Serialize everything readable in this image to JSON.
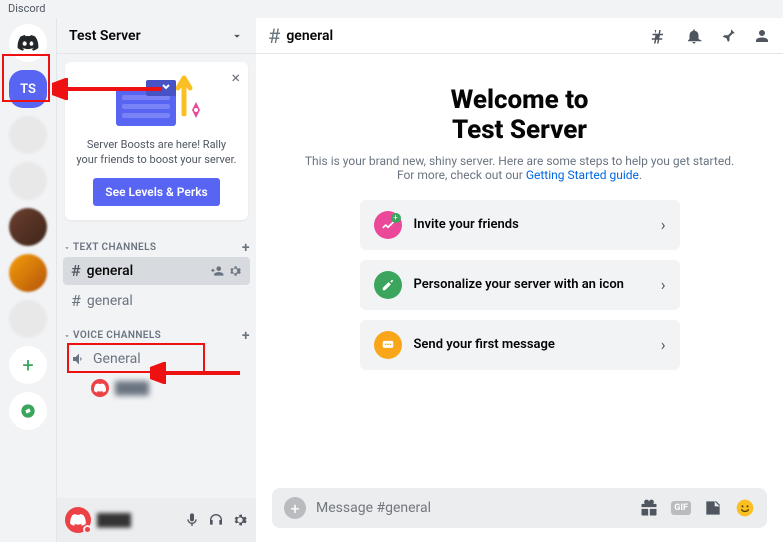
{
  "app": {
    "title": "Discord"
  },
  "server_rail": {
    "selected_label": "TS"
  },
  "sidebar": {
    "server_name": "Test Server",
    "boost": {
      "text": "Server Boosts are here! Rally your friends to boost your server.",
      "button": "See Levels & Perks"
    },
    "sections": {
      "text_channels": {
        "label": "TEXT CHANNELS",
        "items": [
          {
            "name": "general",
            "active": true
          },
          {
            "name": "general",
            "active": false
          }
        ]
      },
      "voice_channels": {
        "label": "VOICE CHANNELS",
        "items": [
          {
            "name": "General"
          }
        ]
      }
    }
  },
  "main": {
    "channel_name": "general",
    "welcome": {
      "title_line1": "Welcome to",
      "title_line2": "Test Server",
      "subtitle_pre": "This is your brand new, shiny server. Here are some steps to help you get started. For more, check out our ",
      "subtitle_link": "Getting Started guide",
      "subtitle_post": "."
    },
    "cards": [
      {
        "label": "Invite your friends"
      },
      {
        "label": "Personalize your server with an icon"
      },
      {
        "label": "Send your first message"
      }
    ],
    "composer": {
      "placeholder": "Message #general",
      "gif_label": "GIF"
    }
  }
}
